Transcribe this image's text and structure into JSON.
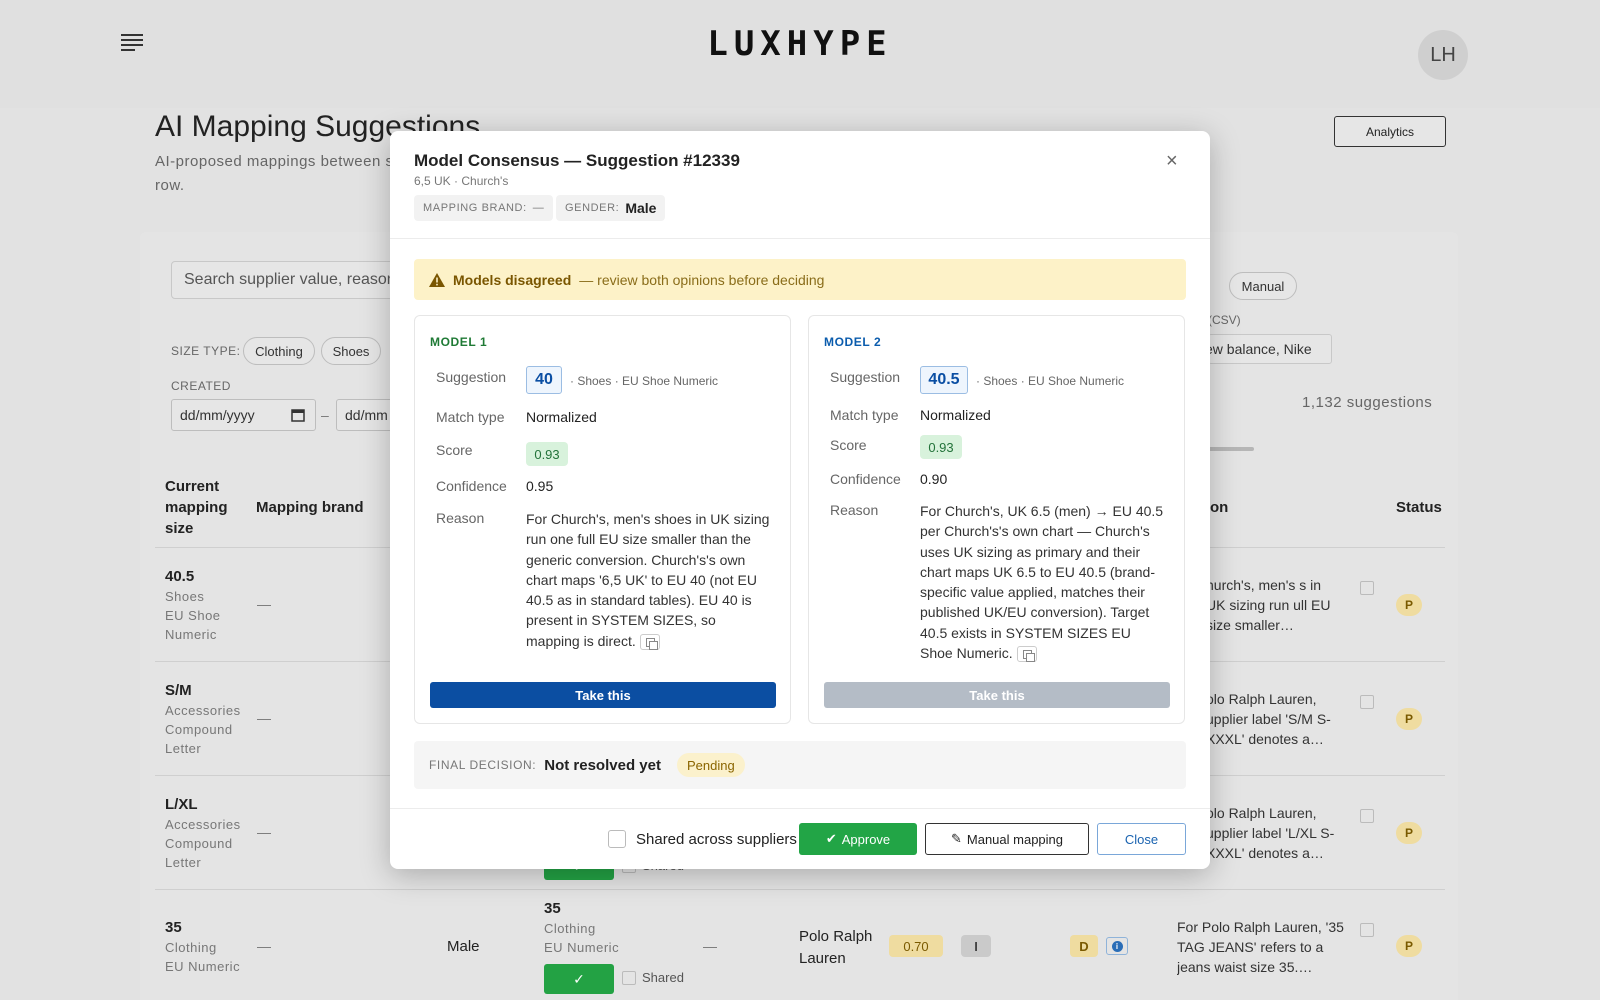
{
  "app": {
    "logo": "LUXHYPE",
    "avatar_initials": "LH"
  },
  "page": {
    "title": "AI Mapping Suggestions",
    "subtitle": "AI-proposed mappings between s",
    "subtitle_line2": "row.",
    "analytics_label": "Analytics",
    "search_placeholder": "Search supplier value, reason",
    "size_type_label": "SIZE TYPE:",
    "size_type_chips": [
      "Clothing",
      "Shoes"
    ],
    "right_chip": "Manual",
    "created_label": "CREATED",
    "date_from_placeholder": "dd/mm/yyyy",
    "date_separator": "–",
    "date_to_placeholder": "dd/mm",
    "csv_label": "(CSV)",
    "brand_filter_value": "ew balance, Nike",
    "suggestions_count": "1,132 suggestions"
  },
  "table": {
    "headers": {
      "current_mapping_size": "Current mapping size",
      "mapping_brand": "Mapping brand",
      "reason": "on",
      "status": "Status"
    },
    "rows": [
      {
        "size": "40.5",
        "type": "Shoes",
        "subtype": "EU Shoe Numeric",
        "brand": "—",
        "reason": "hurch's, men's s in UK sizing run ull EU size smaller…",
        "status": "P"
      },
      {
        "size": "S/M",
        "type": "Accessories",
        "subtype": "Compound Letter",
        "brand": "—",
        "reason": "olo Ralph Lauren, upplier label 'S/M S-XXXL' denotes a…",
        "status": "P"
      },
      {
        "size": "L/XL",
        "type": "Accessories",
        "subtype": "Compound Letter",
        "brand": "—",
        "reason": "olo Ralph Lauren, upplier label 'L/XL S-XXXL' denotes a…",
        "status": "P"
      },
      {
        "size": "35",
        "type": "Clothing",
        "subtype": "EU Numeric",
        "brand": "—",
        "gender": "Male",
        "suggested_size": "35",
        "suggested_type": "Clothing",
        "suggested_subtype": "EU Numeric",
        "dash2": "—",
        "supplier_brand": "Polo Ralph Lauren",
        "score": "0.70",
        "tag": "I",
        "tag2": "D",
        "reason": "For Polo Ralph Lauren, '35 TAG JEANS' refers to a jeans waist size 35.…",
        "status": "P",
        "shared_label": "Shared"
      }
    ],
    "partial_shared_label": "Shared"
  },
  "modal": {
    "title": "Model Consensus — Suggestion #12339",
    "subtitle": "6,5 UK · Church's",
    "close_glyph": "×",
    "meta": [
      {
        "key": "MAPPING BRAND:",
        "value": "—"
      },
      {
        "key": "GENDER:",
        "value": "Male"
      }
    ],
    "warning": {
      "strong": "Models disagreed",
      "rest": "— review both opinions before deciding"
    },
    "field_labels": {
      "suggestion": "Suggestion",
      "match_type": "Match type",
      "score": "Score",
      "confidence": "Confidence",
      "reason": "Reason"
    },
    "models": [
      {
        "label": "MODEL 1",
        "color": "#1f7a35",
        "suggestion": "40",
        "suggestion_meta": "· Shoes · EU Shoe Numeric",
        "match_type": "Normalized",
        "score": "0.93",
        "confidence": "0.95",
        "reason": "For Church's, men's shoes in UK sizing run one full EU size smaller than the generic conversion. Church's's own chart maps '6,5 UK' to EU 40 (not EU 40.5 as in standard tables). EU 40 is present in SYSTEM SIZES, so mapping is direct.",
        "take_label": "Take this",
        "take_color": "#0b4ea2"
      },
      {
        "label": "MODEL 2",
        "color": "#0b5cad",
        "suggestion": "40.5",
        "suggestion_meta": "· Shoes · EU Shoe Numeric",
        "match_type": "Normalized",
        "score": "0.93",
        "confidence": "0.90",
        "reason": "For Church's, UK 6.5 (men) → EU 40.5 per Church's's own chart — Church's uses UK sizing as primary and their chart maps UK 6.5 to EU 40.5 (brand-specific value applied, matches their published UK/EU conversion). Target 40.5 exists in SYSTEM SIZES EU Shoe Numeric.",
        "take_label": "Take this",
        "take_color": "#b4bcc6"
      }
    ],
    "final_decision": {
      "key": "FINAL DECISION:",
      "value": "Not resolved yet",
      "status": "Pending"
    },
    "footer": {
      "shared_label": "Shared across suppliers",
      "approve_label": "Approve",
      "manual_label": "Manual mapping",
      "close_label": "Close"
    }
  }
}
